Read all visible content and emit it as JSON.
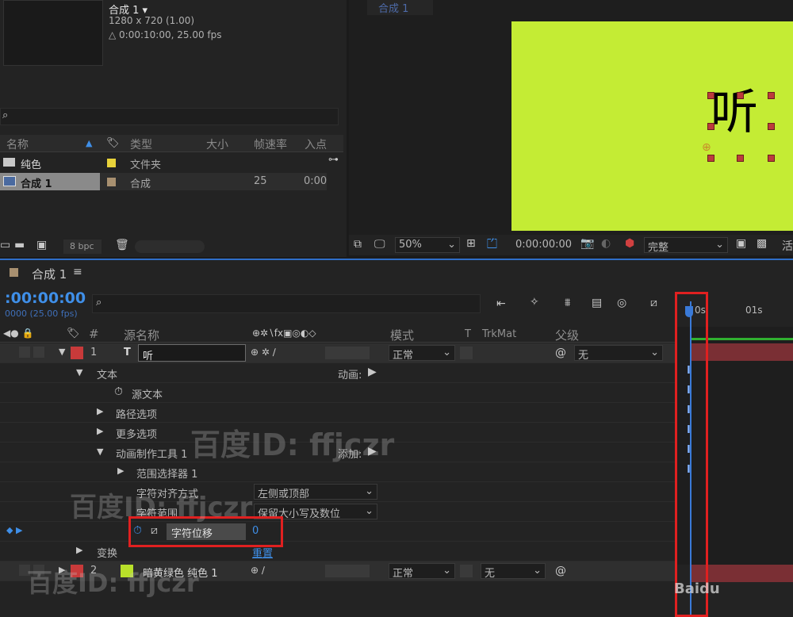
{
  "project": {
    "comp_name": "合成 1 ▾",
    "resolution": "1280 x 720 (1.00)",
    "duration": "△ 0:00:10:00, 25.00 fps",
    "search_glyph": "⌕",
    "columns": [
      "名称",
      "类型",
      "大小",
      "帧速率",
      "入点"
    ],
    "items": [
      {
        "name": "纯色",
        "type": "文件夹",
        "fps": "",
        "in": "",
        "color": "#e8d23a"
      },
      {
        "name": "合成 1",
        "type": "合成",
        "fps": "25",
        "in": "0:00",
        "color": "#a89070"
      }
    ],
    "bpc": "8 bpc"
  },
  "viewer": {
    "tab": "合成 1",
    "glyph": "听",
    "zoom": "50%",
    "timecode": "0:00:00:00",
    "quality": "完整",
    "trailing": "活"
  },
  "timeline": {
    "name": "合成 1",
    "timecode": ":00:00:00",
    "timecode_sub": "0000 (25.00 fps)",
    "columns": {
      "num": "#",
      "source": "源名称",
      "mode": "模式",
      "t": "T",
      "trkmat": "TrkMat",
      "parent": "父级"
    },
    "ruler": [
      "0s",
      "01s"
    ],
    "layer1": {
      "num": "1",
      "type_icon": "T",
      "name": "听",
      "mode": "正常",
      "parent": "无",
      "color": "#c83a3a"
    },
    "text_group": "文本",
    "animate_label": "动画:",
    "source_text": "源文本",
    "path_options": "路径选项",
    "more_options": "更多选项",
    "animator": "动画制作工具 1",
    "add_label": "添加:",
    "range_selector": "范围选择器 1",
    "char_align_label": "字符对齐方式",
    "char_align_value": "左侧或顶部",
    "char_range_label": "字符范围",
    "char_range_value": "保留大小写及数位",
    "char_offset_label": "字符位移",
    "char_offset_value": "0",
    "transform": "变换",
    "reset": "重置",
    "layer2": {
      "num": "2",
      "name": "暗黄绿色 纯色 1",
      "mode": "正常",
      "trkmat": "无",
      "color": "#c83a3a",
      "swatch": "#b8e02a"
    }
  },
  "watermark": {
    "text1": "百度ID: ffjczr",
    "text2": "百度ID: ffjczr",
    "text3": "百度ID: ffjczr",
    "baidu": "Baidu"
  }
}
